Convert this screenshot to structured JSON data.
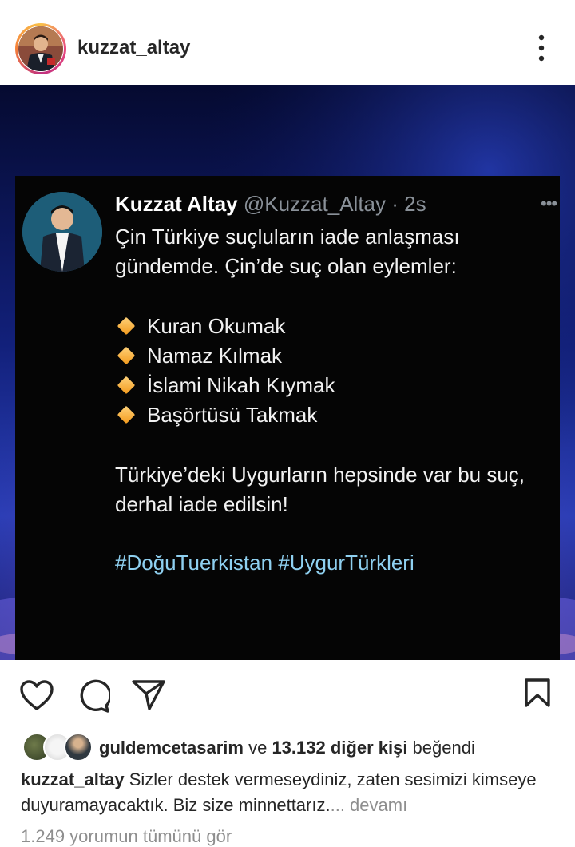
{
  "header": {
    "username": "kuzzat_altay"
  },
  "tweet": {
    "name": "Kuzzat Altay",
    "handle": "@Kuzzat_Altay",
    "separator": " · ",
    "time": "2s",
    "intro": "Çin Türkiye suçluların iade anlaşması gündemde. Çin’de suç olan eylemler:",
    "items": [
      "Kuran Okumak",
      "Namaz Kılmak",
      "İslami Nikah Kıymak",
      "Başörtüsü Takmak"
    ],
    "outro": "Türkiye’deki Uygurların hepsinde var bu suç, derhal iade edilsin!",
    "hashtags": "#DoğuTuerkistan #UygurTürkleri"
  },
  "likes": {
    "first_user": "guldemcetasarim",
    "connector": " ve ",
    "others": "13.132 diğer kişi",
    "suffix": " beğendi"
  },
  "caption": {
    "author": "kuzzat_altay",
    "text": " Sizler destek vermeseydiniz, zaten sesimizi kimseye duyuramayacaktık. Biz size minnettarız.",
    "more": "... devamı"
  },
  "comments_link": "1.249 yorumun tümünü gör",
  "colors": {
    "story_ring": "#e8487f",
    "hashtag": "#8fd0f0",
    "diamond": "#f39a1c"
  },
  "icons": [
    "more-vertical-icon",
    "heart-icon",
    "comment-icon",
    "share-icon",
    "bookmark-icon",
    "diamond-bullet-icon"
  ]
}
